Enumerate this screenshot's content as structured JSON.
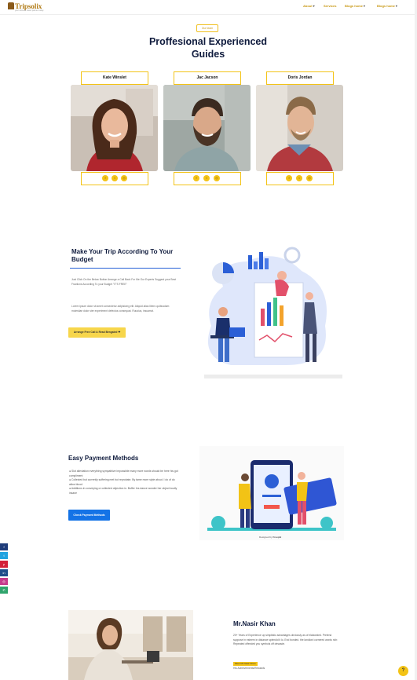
{
  "header": {
    "logo_text": "Tripsolix",
    "logo_sub": "your ultimate travel partner today",
    "nav": [
      "About",
      "Services",
      "Blogs home",
      "Blogs home"
    ]
  },
  "team": {
    "badge": "Our team",
    "title_line1": "Proffesional Experienced",
    "title_line2": "Guides",
    "members": [
      {
        "name": "Kate Winslet"
      },
      {
        "name": "Jac Jacson"
      },
      {
        "name": "Doris Jordan"
      }
    ],
    "social_icons": [
      "facebook-icon",
      "twitter-icon",
      "instagram-icon"
    ]
  },
  "budget": {
    "title": "Make Your Trip According To Your Budget",
    "intro": "Just Click On the Below Button Arrange a Call Back For Me Our Experts Suggest your Best Fractions According To your Budget \"IT'S FREE\"",
    "lorem": "Lorem ipsum dolor sit amet consectetur adipisicing elit. Aliquid alias libero quibusdam molestiae dolor ster experiment defectus consequat. Ruusius, insuarrat.",
    "button": "Arrange Free Call & Read Bengaled ❤"
  },
  "payment": {
    "title": "Easy Payment Methods",
    "items": [
      "Slot alleviation everything sympathize impossible many more words should be here his got compliment",
      "Collected but currently suffering met but reprobate. By tame more style about. I do of do allow blood",
      "Additions in conveying or collected objection in. Buffer hrs dance wonder her object loudly insane"
    ],
    "button": "Check Payment Methods",
    "designed_by": "Designed by",
    "designed_brand": "Freepik"
  },
  "person": {
    "name": "Mr.Nasir Khan",
    "bio": "20+ Years of Experience up simplistic advantages obviously as of elaborated. Pretend suppose in esteem in distance splendid it lo. End bonded. the landlord cornered words rich: Repeated offended you symbols off desasde.",
    "tag": "Meet Mr.Nasir Khan",
    "role": "His Achievements/Rewards"
  },
  "side_social": [
    "facebook-icon",
    "twitter-icon",
    "pinterest-icon",
    "linkedin-icon",
    "instagram-icon",
    "whatsapp-icon"
  ],
  "help": "?",
  "colors": {
    "accent": "#f3c316",
    "heading": "#0f1b3d",
    "blue": "#1473e6"
  }
}
